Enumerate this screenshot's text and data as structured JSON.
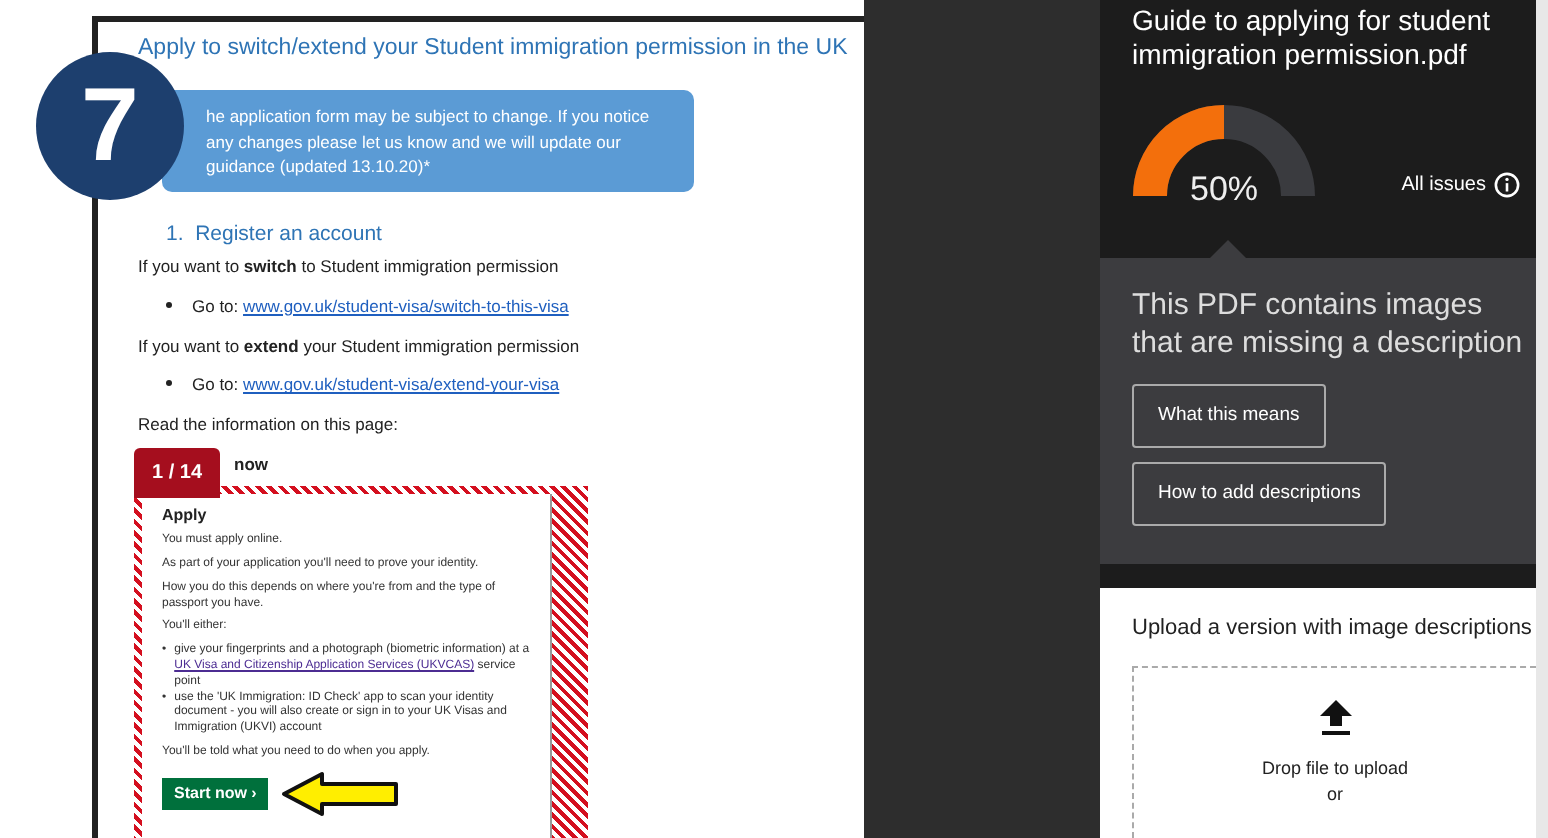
{
  "step_badge": "7",
  "document": {
    "heading": "Apply to switch/extend your Student immigration permission in the UK",
    "notice": "he application form may be subject to change. If you notice any changes please let us know and we will update our guidance (updated 13.10.20)*",
    "section": {
      "number": "1.",
      "title": "Register an account"
    },
    "paragraphs": [
      {
        "kind": "text",
        "text": "If you want to **switch** to Student immigration permission"
      },
      {
        "kind": "bullet",
        "text": "Go to:",
        "link": "www.gov.uk/student-visa/switch-to-this-visa"
      },
      {
        "kind": "text",
        "text": "If you want to **extend** your Student immigration permission"
      },
      {
        "kind": "bullet",
        "text": "Go to:",
        "link": "www.gov.uk/student-visa/extend-your-visa"
      },
      {
        "kind": "text",
        "text": "Read the information on this page:"
      }
    ],
    "issue_tag": "1 / 14",
    "partial_heading": "now",
    "embedded_page": {
      "title": "Apply",
      "paragraphs": [
        "You must apply online.",
        "As part of your application you'll need to prove your identity.",
        "How you do this depends on where you're from and the type of passport you have.",
        "You'll either:"
      ],
      "bullets": [
        {
          "marker": "•",
          "before": "give your fingerprints and a photograph (biometric information) at a ",
          "link": "UK Visa and Citizenship Application Services (UKVCAS)",
          "after": " service point"
        },
        {
          "marker": "•",
          "before": "use the 'UK Immigration: ID Check' app to scan your identity document - you will also create or sign in to your UK Visas and Immigration (UKVI) account"
        }
      ],
      "closing": "You'll be told what you need to do when you apply.",
      "start_button": "Start now",
      "start_chevron": "›"
    }
  },
  "report": {
    "file_title": "Guide to applying for student immigration permission.pdf",
    "score": {
      "level": 0.5,
      "reading": "50%"
    },
    "all_issues": "All issues",
    "issue": {
      "message": "This PDF contains images that are missing a description",
      "buttons": [
        "What this means",
        "How to add descriptions"
      ]
    },
    "upload": {
      "title": "Upload a version with image descriptions",
      "drop_text": "Drop file to upload",
      "or": "or"
    }
  }
}
